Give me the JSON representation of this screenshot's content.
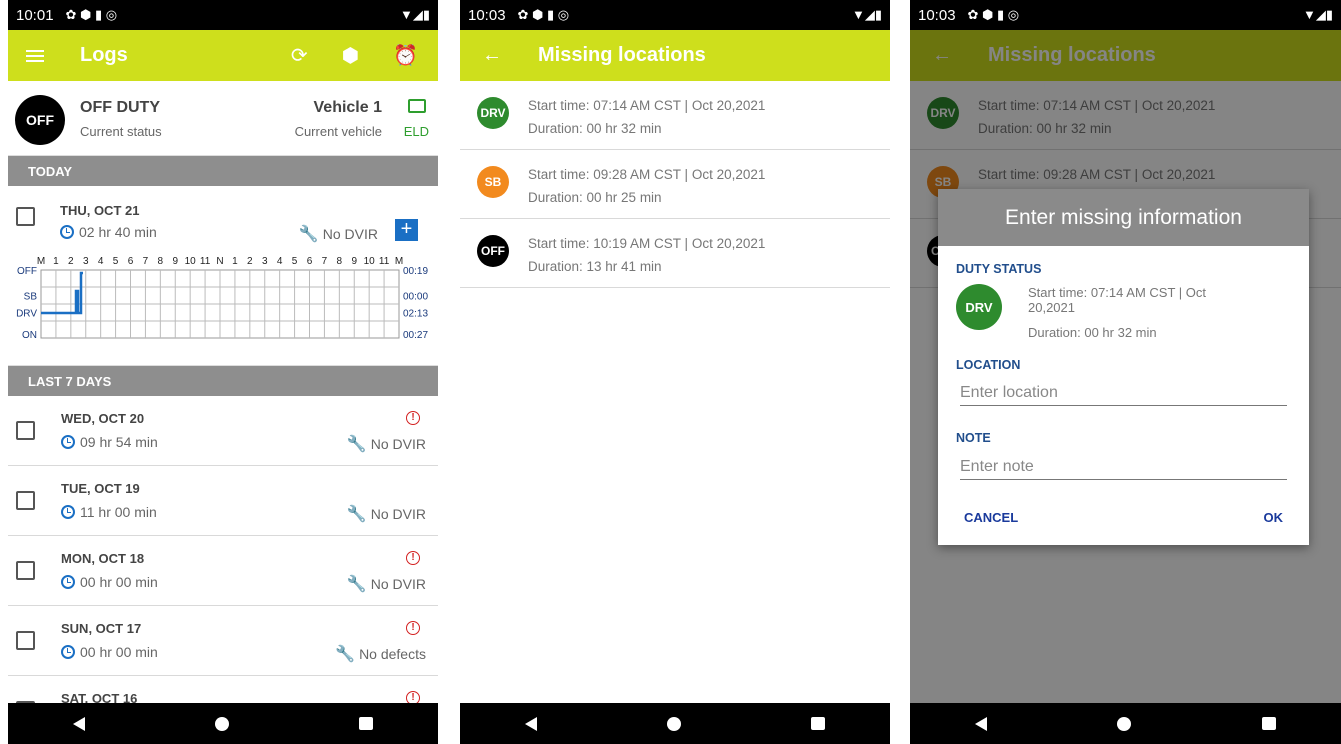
{
  "colors": {
    "accent": "#cedf1c",
    "drv": "#2e8b2e",
    "sb": "#f28a1e",
    "off": "#000000",
    "link": "#1a6fc4",
    "warn": "#d32020"
  },
  "screen1": {
    "status_time": "10:01",
    "title": "Logs",
    "icons": [
      "menu-icon",
      "sync-icon",
      "add-location-icon",
      "alarm-icon"
    ],
    "status_badge": "OFF",
    "status_text": "OFF DUTY",
    "status_sub": "Current status",
    "vehicle": "Vehicle 1",
    "vehicle_sub": "Current vehicle",
    "eld": "ELD",
    "today_header": "TODAY",
    "today": {
      "date": "THU, OCT 21",
      "duration": "02 hr  40 min",
      "dvir": "No DVIR"
    },
    "graph": {
      "hour_labels": [
        "M",
        "1",
        "2",
        "3",
        "4",
        "5",
        "6",
        "7",
        "8",
        "9",
        "10",
        "11",
        "N",
        "1",
        "2",
        "3",
        "4",
        "5",
        "6",
        "7",
        "8",
        "9",
        "10",
        "11",
        "M"
      ],
      "rows": [
        "OFF",
        "SB",
        "DRV",
        "ON"
      ],
      "totals": [
        "00:19",
        "00:00",
        "02:13",
        "00:27"
      ]
    },
    "last7_header": "LAST 7 DAYS",
    "days": [
      {
        "date": "WED, OCT 20",
        "duration": "09 hr  54 min",
        "dvir": "No DVIR",
        "warn": true
      },
      {
        "date": "TUE, OCT 19",
        "duration": "11 hr  00 min",
        "dvir": "No DVIR",
        "warn": false
      },
      {
        "date": "MON, OCT 18",
        "duration": "00 hr  00 min",
        "dvir": "No DVIR",
        "warn": true
      },
      {
        "date": "SUN, OCT 17",
        "duration": "00 hr  00 min",
        "dvir": "No defects",
        "warn": true
      },
      {
        "date": "SAT, OCT 16",
        "duration": "",
        "dvir": "",
        "warn": true
      }
    ]
  },
  "screen2": {
    "status_time": "10:03",
    "title": "Missing locations",
    "items": [
      {
        "badge": "DRV",
        "start": "Start time: 07:14 AM CST | Oct 20,2021",
        "duration": "Duration: 00 hr  32 min"
      },
      {
        "badge": "SB",
        "start": "Start time: 09:28 AM CST | Oct 20,2021",
        "duration": "Duration: 00 hr  25 min"
      },
      {
        "badge": "OFF",
        "start": "Start time: 10:19 AM CST | Oct 20,2021",
        "duration": "Duration: 13 hr  41 min"
      }
    ]
  },
  "dialog": {
    "title": "Enter missing information",
    "duty_label": "DUTY STATUS",
    "badge": "DRV",
    "start_line1": "Start time: 07:14 AM CST | Oct",
    "start_line2": "20,2021",
    "duration": "Duration: 00 hr  32 min",
    "location_label": "LOCATION",
    "location_placeholder": "Enter location",
    "note_label": "NOTE",
    "note_placeholder": "Enter note",
    "cancel": "CANCEL",
    "ok": "OK"
  }
}
